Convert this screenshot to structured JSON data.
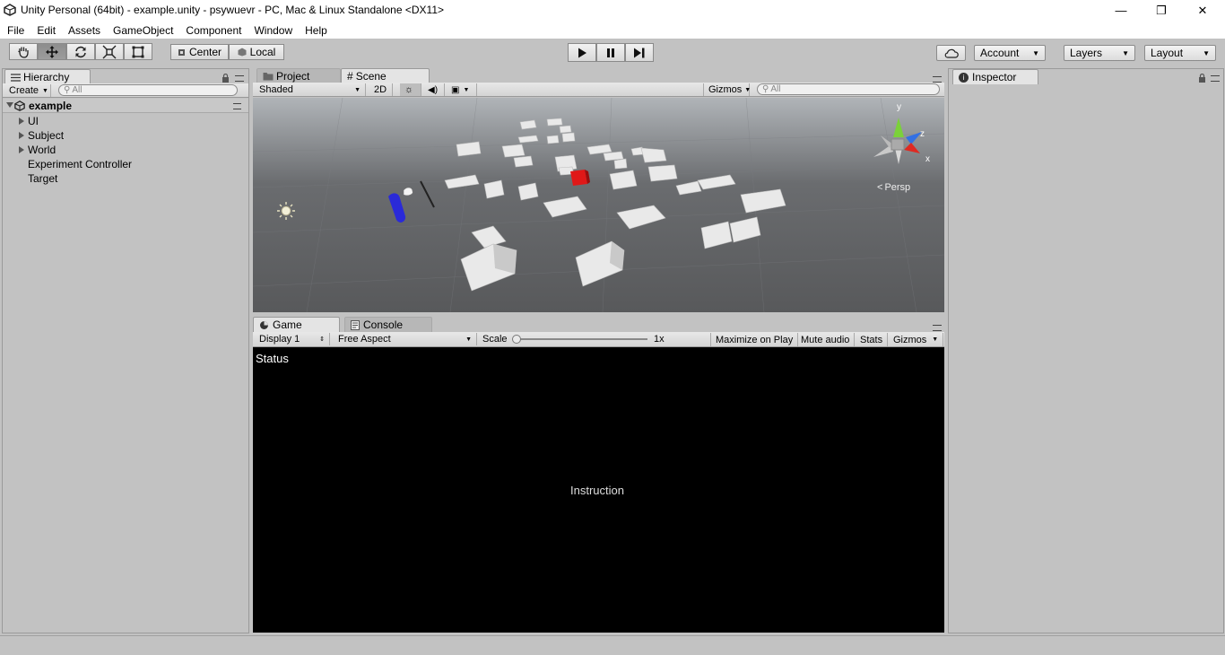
{
  "window": {
    "title": "Unity Personal (64bit) - example.unity - psywuevr - PC, Mac & Linux Standalone <DX11>",
    "minimize": "—",
    "maximize": "❐",
    "close": "✕"
  },
  "menu": [
    "File",
    "Edit",
    "Assets",
    "GameObject",
    "Component",
    "Window",
    "Help"
  ],
  "toolbar": {
    "pivot_label": "Center",
    "space_label": "Local",
    "account_label": "Account",
    "layers_label": "Layers",
    "layout_label": "Layout"
  },
  "hierarchy": {
    "tab_label": "Hierarchy",
    "create_label": "Create",
    "search_placeholder": "All",
    "scene_name": "example",
    "items": [
      {
        "label": "UI",
        "expandable": true
      },
      {
        "label": "Subject",
        "expandable": true
      },
      {
        "label": "World",
        "expandable": true
      },
      {
        "label": "Experiment Controller",
        "expandable": false
      },
      {
        "label": "Target",
        "expandable": false
      }
    ]
  },
  "scene": {
    "project_tab": "Project",
    "scene_tab": "Scene",
    "shading_mode": "Shaded",
    "mode_2d": "2D",
    "gizmos_label": "Gizmos",
    "search_placeholder": "All",
    "persp_label": "Persp",
    "axis_y": "y",
    "axis_z": "z",
    "axis_x": "x"
  },
  "game": {
    "game_tab": "Game",
    "console_tab": "Console",
    "display": "Display 1",
    "aspect": "Free Aspect",
    "scale_label": "Scale",
    "scale_value": "1x",
    "maximize_on_play": "Maximize on Play",
    "mute_audio": "Mute audio",
    "stats": "Stats",
    "gizmos": "Gizmos",
    "status_text": "Status",
    "instruction_text": "Instruction"
  },
  "inspector": {
    "tab_label": "Inspector"
  },
  "colors": {
    "panel": "#c2c2c2",
    "red_cube": "#e01818",
    "blue_capsule": "#2a2ad8"
  }
}
